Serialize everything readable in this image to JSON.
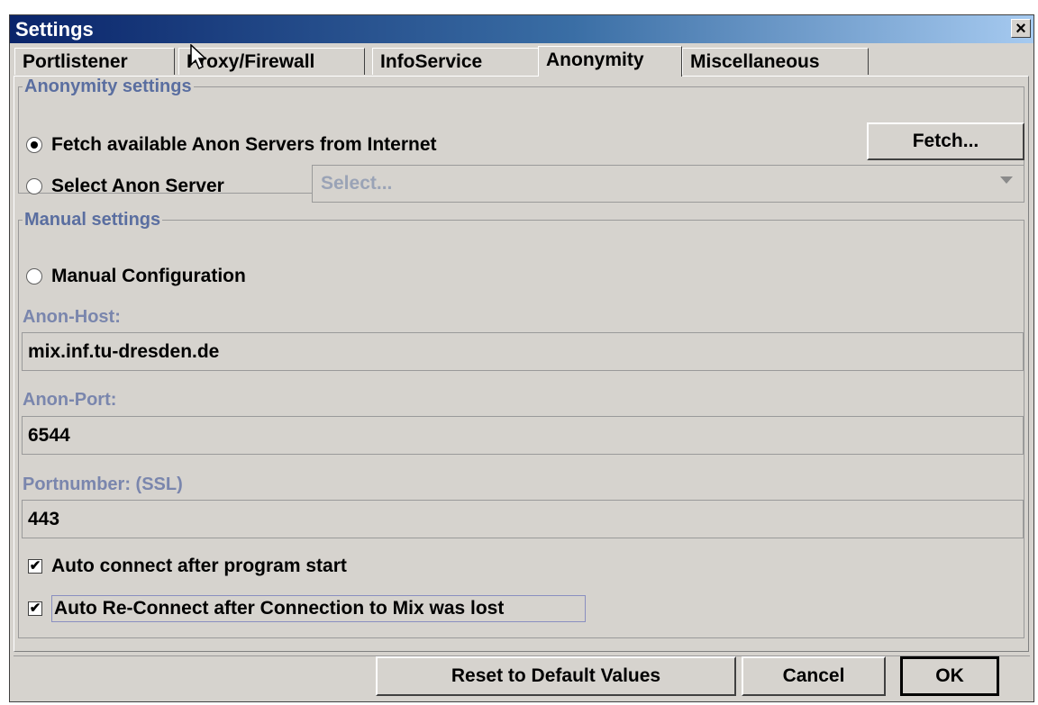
{
  "window": {
    "title": "Settings",
    "close_glyph": "×"
  },
  "tabs": [
    {
      "label": "Portlistener",
      "active": false
    },
    {
      "label": "Proxy/Firewall",
      "active": false
    },
    {
      "label": "InfoService",
      "active": false
    },
    {
      "label": "Anonymity",
      "active": true
    },
    {
      "label": "Miscellaneous",
      "active": false
    }
  ],
  "anonymity_group": {
    "legend": "Anonymity settings",
    "fetch_radio_label": "Fetch available Anon Servers from Internet",
    "fetch_button": "Fetch...",
    "select_radio_label": "Select Anon Server",
    "select_value": "Select..."
  },
  "manual_group": {
    "legend": "Manual settings",
    "manual_radio_label": "Manual Configuration",
    "host_label": "Anon-Host:",
    "host_value": "mix.inf.tu-dresden.de",
    "port_label": "Anon-Port:",
    "port_value": "6544",
    "ssl_label": "Portnumber: (SSL)",
    "ssl_value": "443",
    "auto_connect_label": "Auto connect after program start",
    "auto_connect_checked": true,
    "auto_reconnect_label": "Auto Re-Connect after Connection to Mix was lost",
    "auto_reconnect_checked": true,
    "check_glyph": "✔"
  },
  "footer": {
    "reset_button": "Reset to Default Values",
    "cancel_button": "Cancel",
    "ok_button": "OK"
  },
  "colors": {
    "titlebar_start": "#0a246a",
    "titlebar_end": "#a6caf0",
    "dialog_bg": "#d6d3ce",
    "legend_text": "#5a6ea0"
  },
  "icons": {
    "cursor": "mouse-pointer-icon",
    "close": "close-icon",
    "dropdown": "chevron-down-icon"
  }
}
